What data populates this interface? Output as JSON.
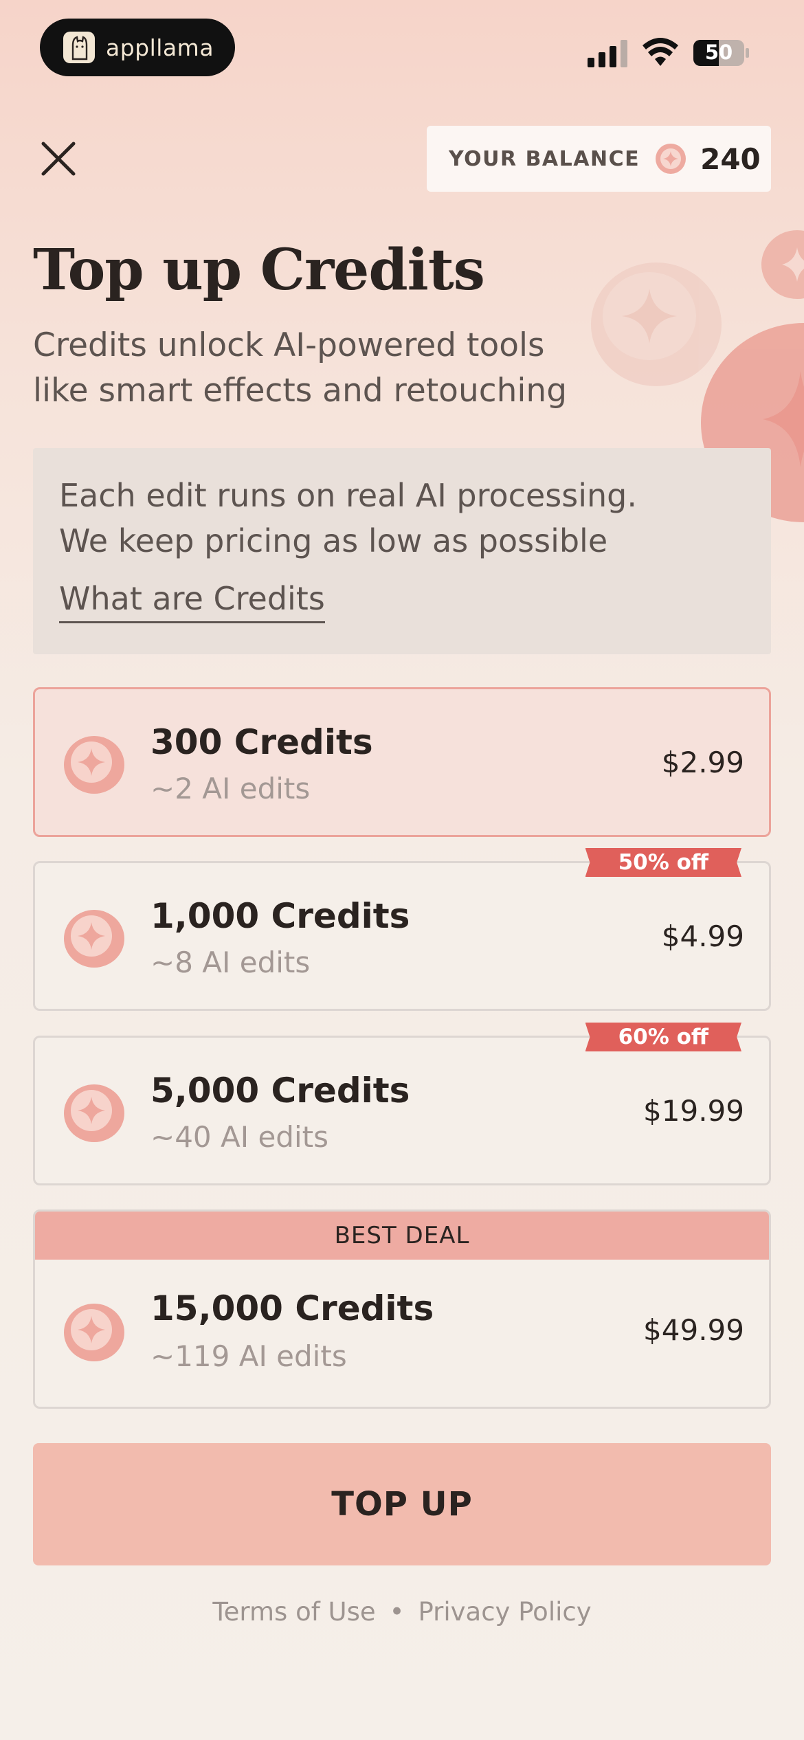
{
  "status_bar": {
    "app_name": "appllama",
    "battery": "50"
  },
  "balance": {
    "label": "YOUR BALANCE",
    "value": "240"
  },
  "header": {
    "title": "Top up Credits",
    "subtitle_line1": "Credits unlock AI-powered tools",
    "subtitle_line2": "like smart effects and retouching"
  },
  "info": {
    "line1": "Each edit runs on real AI processing.",
    "line2": "We keep pricing as low as possible",
    "link": "What are Credits"
  },
  "packages": [
    {
      "name": "300 Credits",
      "edits": "~2 AI edits",
      "price": "$2.99",
      "badge": ""
    },
    {
      "name": "1,000 Credits",
      "edits": "~8 AI edits",
      "price": "$4.99",
      "badge": "50% off"
    },
    {
      "name": "5,000 Credits",
      "edits": "~40 AI edits",
      "price": "$19.99",
      "badge": "60% off"
    },
    {
      "name": "15,000 Credits",
      "edits": "~119 AI edits",
      "price": "$49.99",
      "badge": "BEST DEAL"
    }
  ],
  "cta": {
    "label": "TOP UP"
  },
  "footer": {
    "terms": "Terms of Use",
    "separator": "•",
    "privacy": "Privacy Policy"
  },
  "colors": {
    "accent": "#eca39a",
    "badge": "#e0605b",
    "button": "#f2bbae"
  }
}
